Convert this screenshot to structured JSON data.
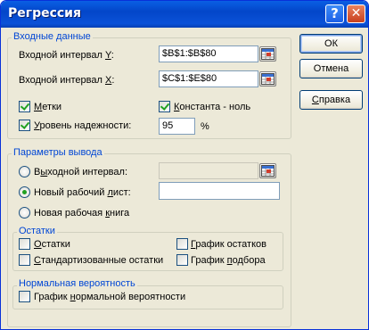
{
  "window": {
    "title": "Регрессия"
  },
  "title_buttons": {
    "help": "?",
    "close": "✕"
  },
  "input_group": {
    "title": "Входные данные",
    "y_range_label_pre": "Входной интервал ",
    "y_range_label_key": "Y",
    "y_range_label_post": ":",
    "y_range_value": "$B$1:$B$80",
    "x_range_label_pre": "Входной интервал ",
    "x_range_label_key": "X",
    "x_range_label_post": ":",
    "x_range_value": "$C$1:$E$80",
    "labels_checkbox_pre": "",
    "labels_checkbox_key": "М",
    "labels_checkbox_post": "етки",
    "labels_checked": true,
    "constant_zero_pre": "",
    "constant_zero_key": "К",
    "constant_zero_post": "онстанта - ноль",
    "constant_zero_checked": true,
    "confidence_pre": "",
    "confidence_key": "У",
    "confidence_post": "ровень надежности:",
    "confidence_checked": true,
    "confidence_value": "95",
    "confidence_unit": "%"
  },
  "output_group": {
    "title": "Параметры вывода",
    "output_range_pre": "В",
    "output_range_key": "ы",
    "output_range_post": "ходной интервал:",
    "output_range_value": "",
    "new_sheet_pre": "Новый рабочий ",
    "new_sheet_key": "л",
    "new_sheet_post": "ист:",
    "new_sheet_value": "",
    "new_workbook_pre": "Новая рабочая ",
    "new_workbook_key": "к",
    "new_workbook_post": "нига",
    "selected_option": "new_sheet"
  },
  "residuals_group": {
    "title": "Остатки",
    "residuals_pre": "",
    "residuals_key": "О",
    "residuals_post": "статки",
    "std_residuals_pre": "",
    "std_residuals_key": "С",
    "std_residuals_post": "тандартизованные остатки",
    "residual_plots_pre": "",
    "residual_plots_key": "Г",
    "residual_plots_post": "рафик остатков",
    "line_fit_pre": "График ",
    "line_fit_key": "п",
    "line_fit_post": "одбора"
  },
  "normal_group": {
    "title": "Нормальная вероятность",
    "normal_plot_pre": "График ",
    "normal_plot_key": "н",
    "normal_plot_post": "ормальной вероятности"
  },
  "buttons": {
    "ok": "ОК",
    "cancel": "Отмена",
    "help_pre": "",
    "help_key": "С",
    "help_post": "правка"
  },
  "icons": {
    "range_selector": "range-selector-icon"
  },
  "colors": {
    "group_title": "#0046d5",
    "titlebar": "#0a5fe4",
    "face": "#ece9d8",
    "check": "#21a121"
  }
}
